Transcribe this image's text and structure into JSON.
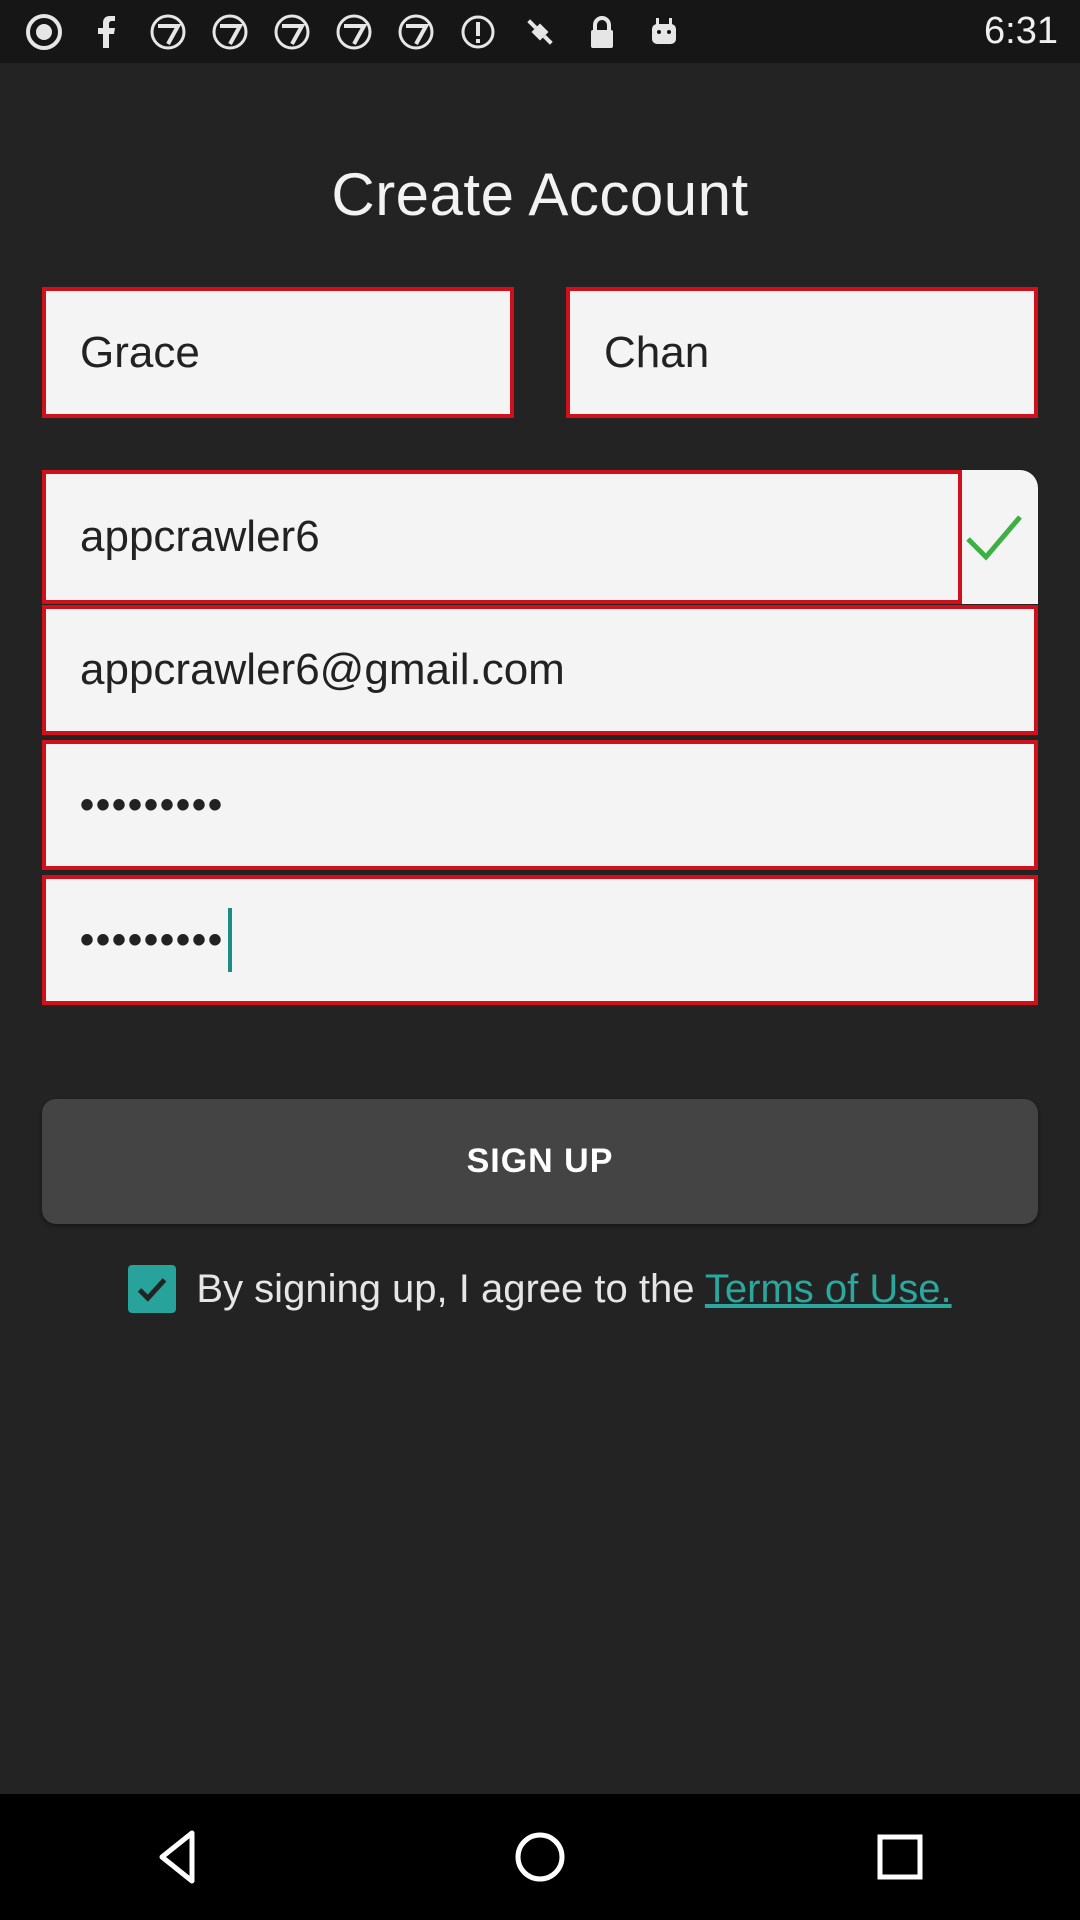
{
  "status_bar": {
    "time": "6:31",
    "icons": [
      "abc-logo-icon",
      "facebook-icon",
      "abc7-icon",
      "abc7-icon",
      "abc7-icon",
      "abc7-icon",
      "abc7-icon",
      "info-icon",
      "fake-gps-icon",
      "lock-icon",
      "android-icon"
    ]
  },
  "form": {
    "title": "Create Account",
    "first_name": "Grace",
    "last_name": "Chan",
    "username": "appcrawler6",
    "email": "appcrawler6@gmail.com",
    "password": "•••••••••",
    "confirm_password": "•••••••••",
    "signup_label": "SIGN UP",
    "agree_text": "By signing up, I agree to the ",
    "terms_link": "Terms of Use."
  },
  "colors": {
    "background": "#232323",
    "field_border": "#d0101a",
    "accent": "#27a39b",
    "button": "#444444",
    "valid_check": "#3cb043"
  }
}
